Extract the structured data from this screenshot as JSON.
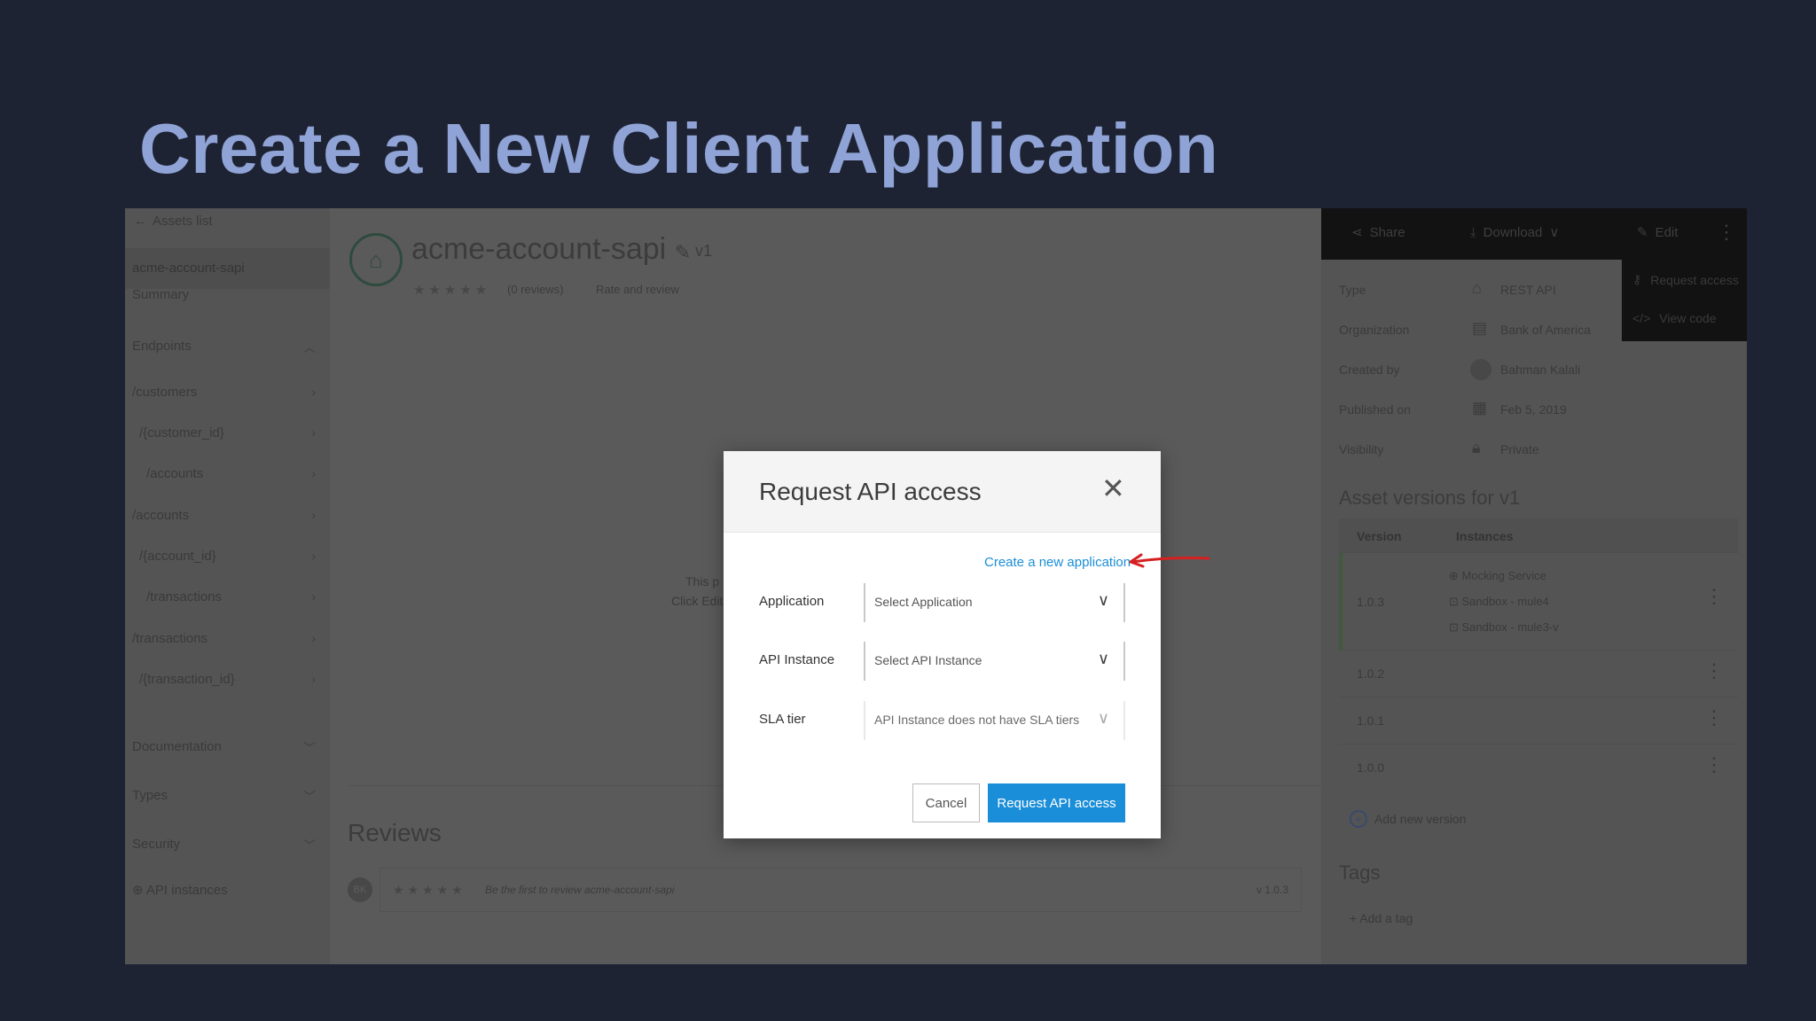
{
  "slide_title": "Create a New Client Application",
  "sidebar": {
    "back_label": "Assets list",
    "active_item": "acme-account-sapi",
    "items": [
      {
        "label": "Summary"
      },
      {
        "label": "Endpoints"
      },
      {
        "label": "/customers"
      },
      {
        "label": "/{customer_id}"
      },
      {
        "label": "/accounts"
      },
      {
        "label": "/accounts"
      },
      {
        "label": "/{account_id}"
      },
      {
        "label": "/transactions"
      },
      {
        "label": "/transactions"
      },
      {
        "label": "/{transaction_id}"
      },
      {
        "label": "Documentation"
      },
      {
        "label": "Types"
      },
      {
        "label": "Security"
      },
      {
        "label": "API instances"
      }
    ]
  },
  "main": {
    "api_name": "acme-account-sapi",
    "version_tag": "v1",
    "reviews_count": "(0 reviews)",
    "rate_link": "Rate and review",
    "partial_line_1": "This p",
    "partial_line_2": "Click Edit",
    "reviews_heading": "Reviews",
    "reviewer_initials": "BK",
    "review_prompt": "Be the first to review acme-account-sapi",
    "review_version": "v 1.0.3"
  },
  "toolbar": {
    "share": "Share",
    "download": "Download",
    "edit": "Edit",
    "menu": {
      "request_access": "Request access",
      "view_code": "View code"
    }
  },
  "details": {
    "type_label": "Type",
    "type_value": "REST API",
    "org_label": "Organization",
    "org_value": "Bank of America",
    "created_label": "Created by",
    "created_value": "Bahman Kalali",
    "published_label": "Published on",
    "published_value": "Feb 5, 2019",
    "visibility_label": "Visibility",
    "visibility_value": "Private"
  },
  "versions": {
    "heading": "Asset versions for v1",
    "col_version": "Version",
    "col_instances": "Instances",
    "rows": [
      {
        "version": "1.0.3",
        "instances": [
          "Mocking Service",
          "Sandbox - mule4",
          "Sandbox - mule3-v"
        ]
      },
      {
        "version": "1.0.2",
        "instances": []
      },
      {
        "version": "1.0.1",
        "instances": []
      },
      {
        "version": "1.0.0",
        "instances": []
      }
    ],
    "add_new_version": "Add new version"
  },
  "tags": {
    "heading": "Tags",
    "add_tag": "+ Add a tag"
  },
  "modal": {
    "title": "Request API access",
    "create_link": "Create a new application",
    "application_label": "Application",
    "application_placeholder": "Select Application",
    "api_instance_label": "API Instance",
    "api_instance_placeholder": "Select API Instance",
    "sla_label": "SLA tier",
    "sla_placeholder": "API Instance does not have SLA tiers",
    "cancel": "Cancel",
    "submit": "Request API access"
  },
  "colors": {
    "slide_background": "#1e2333",
    "title_color": "#8fa3d6",
    "accent_blue": "#1a8ed8",
    "annotation_red": "#d62020"
  },
  "icons": [
    "arrow-left-icon",
    "api-logo-icon",
    "pencil-icon",
    "share-icon",
    "download-icon",
    "edit-icon",
    "more-vertical-icon",
    "key-icon",
    "code-icon",
    "rest-api-icon",
    "organization-icon",
    "calendar-icon",
    "lock-icon",
    "close-icon",
    "chevron-down-icon",
    "plus-circle-icon",
    "globe-icon"
  ]
}
